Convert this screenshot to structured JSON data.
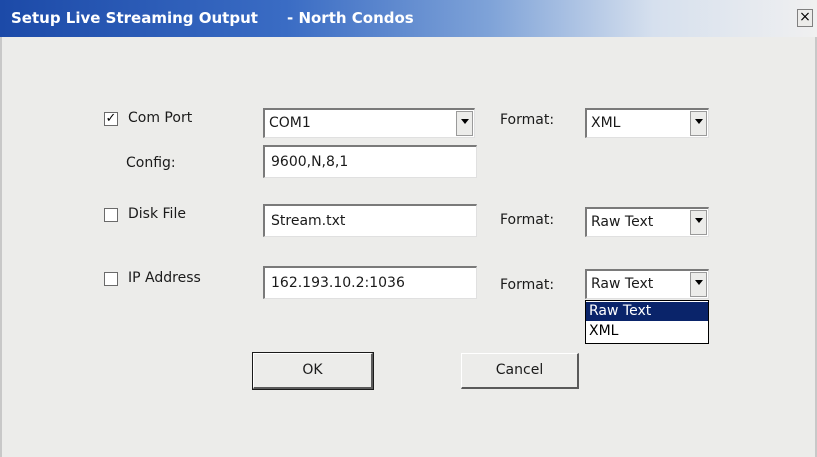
{
  "window": {
    "title": "Setup Live Streaming Output",
    "subtitle": "- North Condos",
    "close_label": "×"
  },
  "com_port": {
    "checkbox_checked": true,
    "checkbox_mark": "✓",
    "label": "Com Port",
    "port_value": "COM1",
    "format_label": "Format:",
    "format_value": "XML",
    "config_label": "Config:",
    "config_value": "9600,N,8,1"
  },
  "disk_file": {
    "checkbox_checked": false,
    "label": "Disk File",
    "file_value": "Stream.txt",
    "format_label": "Format:",
    "format_value": "Raw Text"
  },
  "ip_address": {
    "checkbox_checked": false,
    "label": "IP Address",
    "address_value": "162.193.10.2:1036",
    "format_label": "Format:",
    "format_value": "Raw Text",
    "dropdown_options": [
      "Raw Text",
      "XML"
    ],
    "dropdown_highlighted": "Raw Text"
  },
  "buttons": {
    "ok_label": "OK",
    "cancel_label": "Cancel"
  },
  "colors": {
    "title_bar_start": "#1c4aa8",
    "selection": "#0a246a",
    "dialog_background": "#ececea"
  }
}
